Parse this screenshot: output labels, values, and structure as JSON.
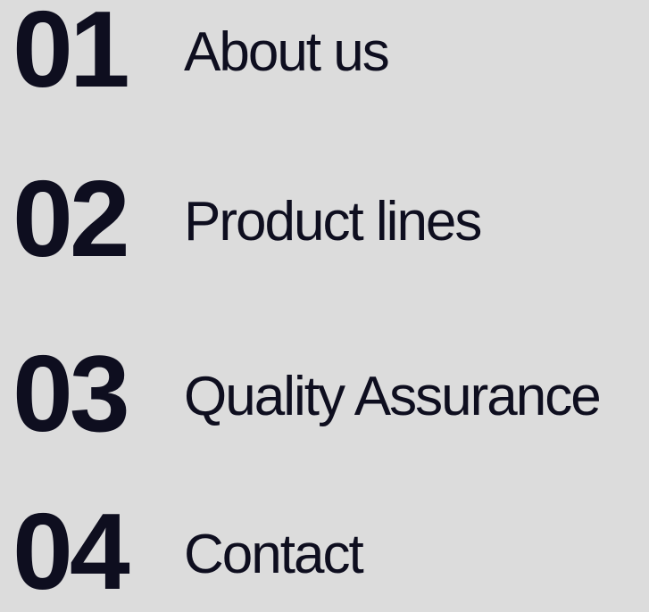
{
  "menu": {
    "items": [
      {
        "number": "01",
        "label": "About us"
      },
      {
        "number": "02",
        "label": "Product lines"
      },
      {
        "number": "03",
        "label": "Quality Assurance"
      },
      {
        "number": "04",
        "label": "Contact"
      }
    ]
  },
  "colors": {
    "background": "#dcdcdc",
    "text": "#0e0e1f"
  }
}
